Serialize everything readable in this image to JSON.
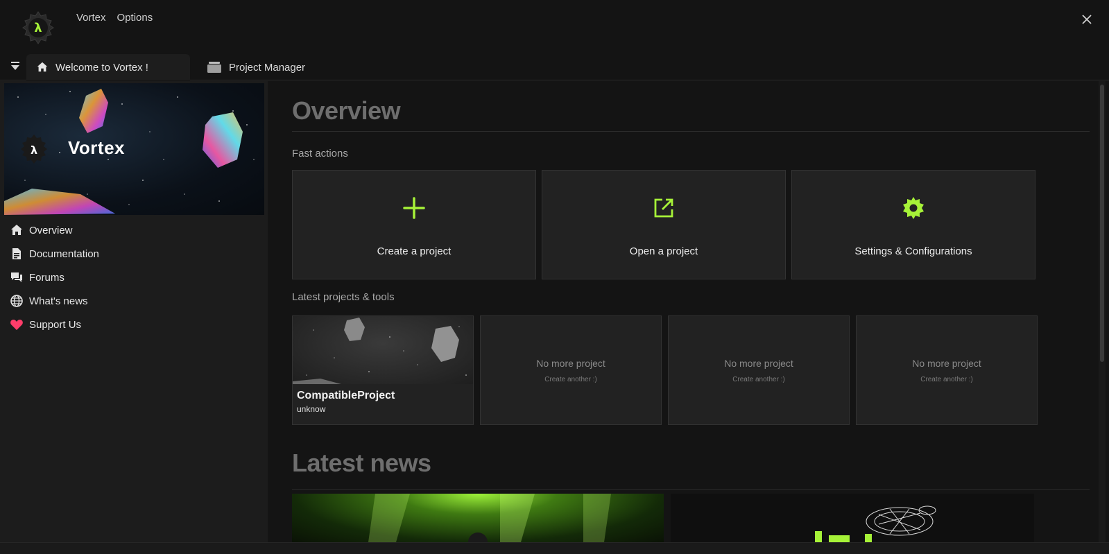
{
  "app": {
    "menu": [
      "Vortex",
      "Options"
    ],
    "close_icon": "close-icon",
    "accent": "#a6f238",
    "logo_glyph": "λ"
  },
  "tabs": [
    {
      "label": "Welcome to Vortex !",
      "icon": "home-icon",
      "active": true
    },
    {
      "label": "Project Manager",
      "icon": "folder-icon",
      "active": false
    }
  ],
  "sidebar": {
    "banner_title": "Vortex",
    "items": [
      {
        "label": "Overview",
        "icon": "home-icon"
      },
      {
        "label": "Documentation",
        "icon": "document-icon"
      },
      {
        "label": "Forums",
        "icon": "forum-icon"
      },
      {
        "label": "What's news",
        "icon": "globe-icon"
      },
      {
        "label": "Support Us",
        "icon": "heart-icon",
        "icon_color": "#ff3d6a"
      }
    ]
  },
  "main": {
    "title": "Overview",
    "fast_actions_label": "Fast actions",
    "actions": [
      {
        "label": "Create a project",
        "icon": "plus-icon"
      },
      {
        "label": "Open a project",
        "icon": "external-link-icon"
      },
      {
        "label": "Settings & Configurations",
        "icon": "gear-icon"
      }
    ],
    "latest_projects_label": "Latest projects & tools",
    "projects": [
      {
        "name": "CompatibleProject",
        "version": "unknow"
      }
    ],
    "empty_slots": [
      {
        "title": "No more project",
        "subtitle": "Create another :)"
      },
      {
        "title": "No more project",
        "subtitle": "Create another :)"
      },
      {
        "title": "No more project",
        "subtitle": "Create another :)"
      }
    ],
    "news_title": "Latest news"
  }
}
